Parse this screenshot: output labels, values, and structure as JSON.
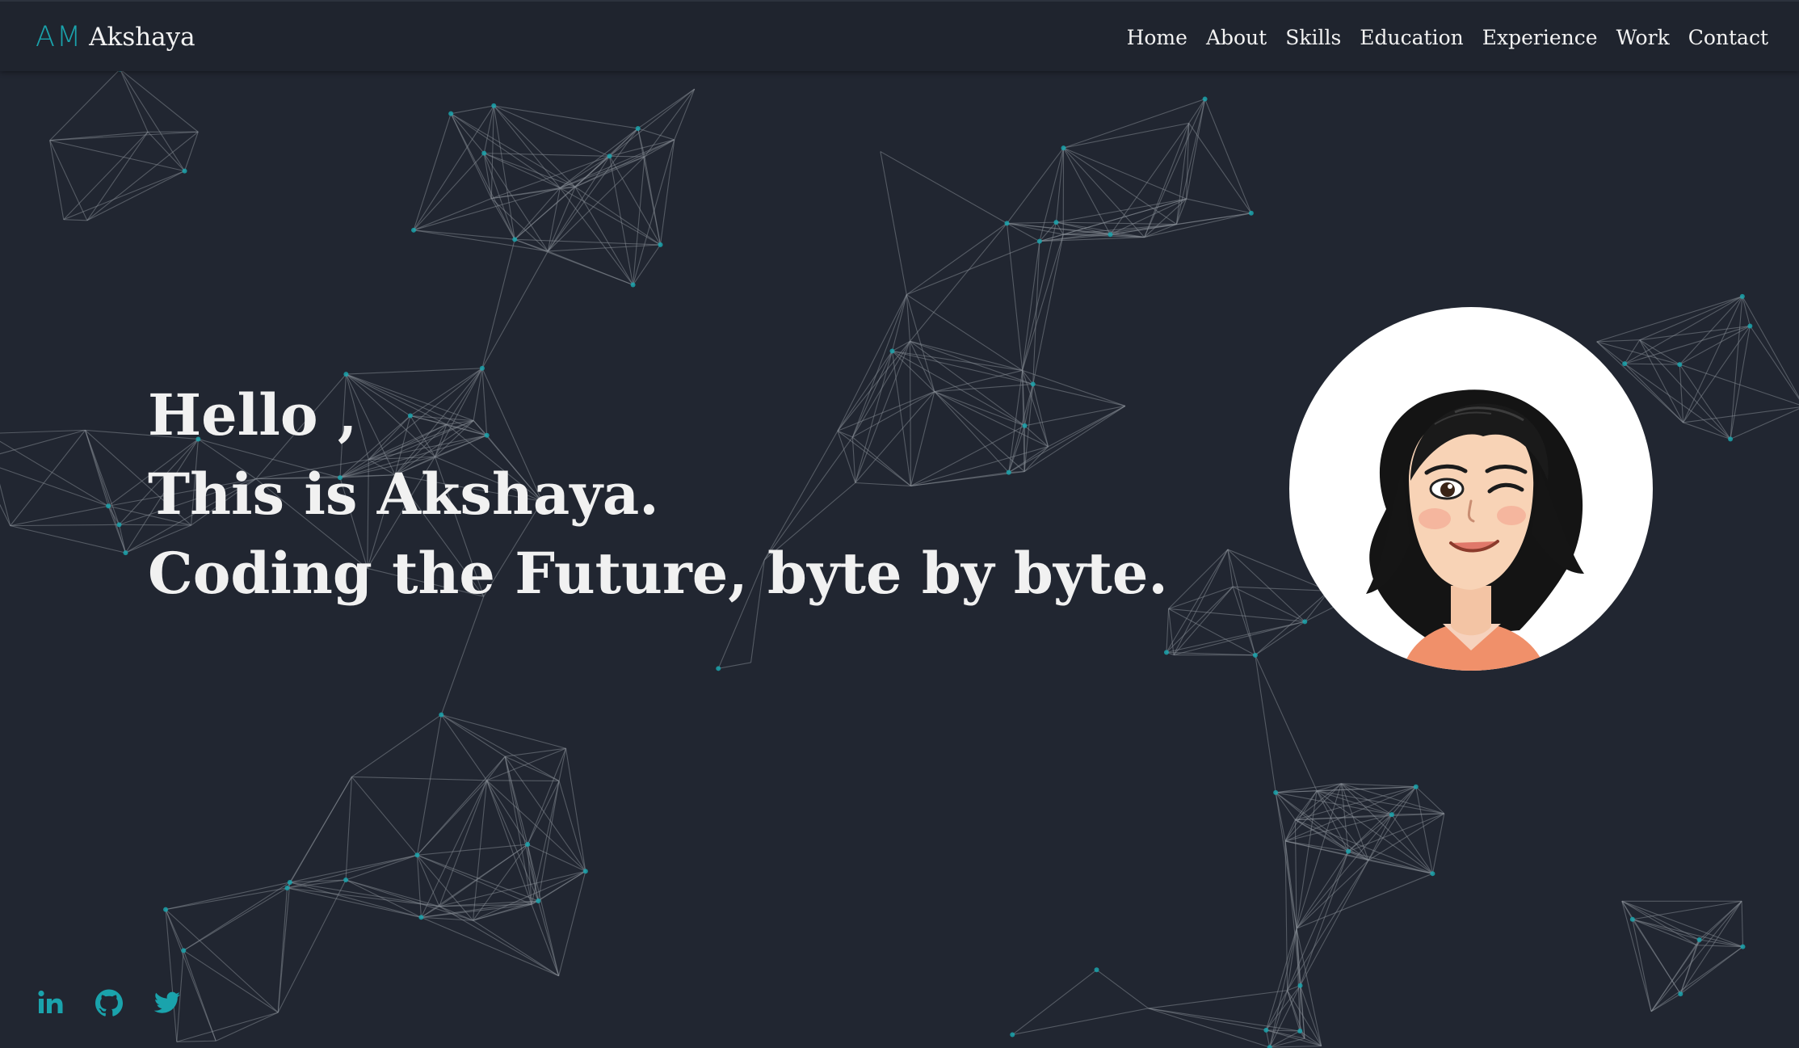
{
  "brand": {
    "logo_text": "AM",
    "name": "Akshaya",
    "accent_color": "#1aa3ac"
  },
  "nav": {
    "items": [
      {
        "label": "Home"
      },
      {
        "label": "About"
      },
      {
        "label": "Skills"
      },
      {
        "label": "Education"
      },
      {
        "label": "Experience"
      },
      {
        "label": "Work"
      },
      {
        "label": "Contact"
      }
    ]
  },
  "hero": {
    "line1": "Hello ,",
    "line2": "This is Akshaya.",
    "line3": "Coding the Future, byte by byte."
  },
  "avatar": {
    "icon": "avatar-winking-woman-illustration"
  },
  "social": {
    "items": [
      {
        "icon": "linkedin-icon"
      },
      {
        "icon": "github-icon"
      },
      {
        "icon": "twitter-icon"
      }
    ]
  },
  "theme": {
    "background": "#212631",
    "navbar_background": "#1f242e",
    "text": "#f1f1f1",
    "particle_node": "#1aa3ac",
    "particle_line": "#8a8f98"
  }
}
